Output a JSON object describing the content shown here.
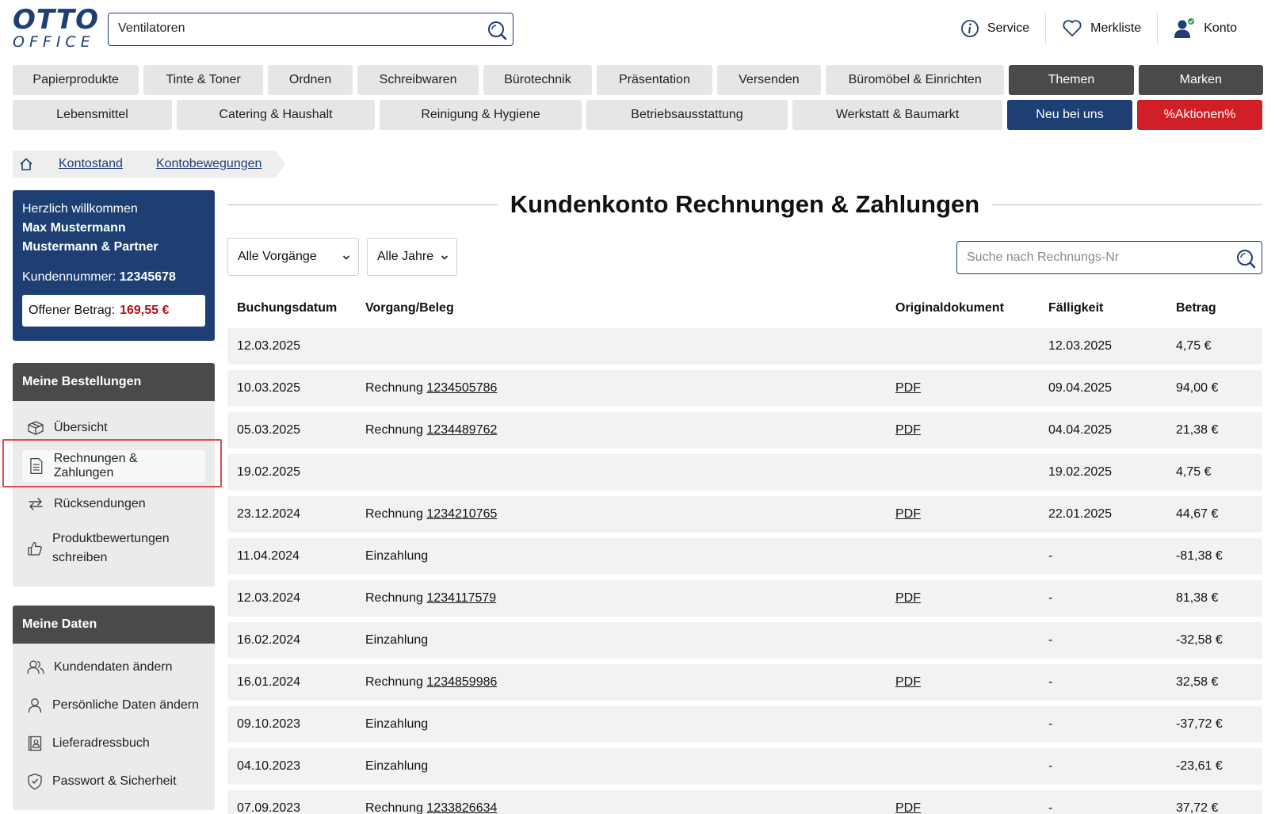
{
  "header": {
    "logo_top": "OTTO",
    "logo_bottom": "OFFICE",
    "search_value": "Ventilatoren",
    "links": {
      "service": "Service",
      "merkliste": "Merkliste",
      "konto": "Konto"
    }
  },
  "nav": {
    "row1": [
      "Papierprodukte",
      "Tinte & Toner",
      "Ordnen",
      "Schreibwaren",
      "Bürotechnik",
      "Präsentation",
      "Versenden",
      "Büromöbel & Einrichten",
      "Themen",
      "Marken"
    ],
    "row2": [
      "Lebensmittel",
      "Catering & Haushalt",
      "Reinigung & Hygiene",
      "Betriebsausstattung",
      "Werkstatt & Baumarkt",
      "Neu bei uns",
      "%Aktionen%"
    ]
  },
  "breadcrumb": [
    "Kontostand",
    "Kontobewegungen"
  ],
  "sidebar": {
    "welcome": {
      "greeting": "Herzlich willkommen",
      "name_line1": "Max Mustermann",
      "name_line2": "Mustermann & Partner",
      "kundennr_label": "Kundennummer:",
      "kundennr": "12345678",
      "offen_label": "Offener Betrag:",
      "offen_value": "169,55 €"
    },
    "bestellungen": {
      "title": "Meine Bestellungen",
      "items": [
        "Übersicht",
        "Rechnungen & Zahlungen",
        "Rücksendungen",
        "Produktbewertungen",
        "schreiben"
      ]
    },
    "daten": {
      "title": "Meine Daten",
      "items": [
        "Kundendaten ändern",
        "Persönliche Daten ändern",
        "Lieferadressbuch",
        "Passwort & Sicherheit"
      ]
    }
  },
  "main": {
    "title": "Kundenkonto Rechnungen & Zahlungen",
    "filter_vorgaenge": "Alle Vorgänge",
    "filter_jahre": "Alle Jahre",
    "search_placeholder": "Suche nach Rechnungs-Nr",
    "columns": [
      "Buchungsdatum",
      "Vorgang/Beleg",
      "Originaldokument",
      "Fälligkeit",
      "Betrag"
    ],
    "rows": [
      {
        "date": "12.03.2025",
        "type": "",
        "nr": "",
        "doc": "",
        "due": "12.03.2025",
        "amount": "4,75 €"
      },
      {
        "date": "10.03.2025",
        "type": "Rechnung",
        "nr": "1234505786",
        "doc": "PDF",
        "due": "09.04.2025",
        "amount": "94,00 €"
      },
      {
        "date": "05.03.2025",
        "type": "Rechnung",
        "nr": "1234489762",
        "doc": "PDF",
        "due": "04.04.2025",
        "amount": "21,38 €"
      },
      {
        "date": "19.02.2025",
        "type": "",
        "nr": "",
        "doc": "",
        "due": "19.02.2025",
        "amount": "4,75 €"
      },
      {
        "date": "23.12.2024",
        "type": "Rechnung",
        "nr": "1234210765",
        "doc": "PDF",
        "due": "22.01.2025",
        "amount": "44,67 €"
      },
      {
        "date": "11.04.2024",
        "type": "Einzahlung",
        "nr": "",
        "doc": "",
        "due": "-",
        "amount": "-81,38 €"
      },
      {
        "date": "12.03.2024",
        "type": "Rechnung",
        "nr": "1234117579",
        "doc": "PDF",
        "due": "-",
        "amount": "81,38 €"
      },
      {
        "date": "16.02.2024",
        "type": "Einzahlung",
        "nr": "",
        "doc": "",
        "due": "-",
        "amount": "-32,58 €"
      },
      {
        "date": "16.01.2024",
        "type": "Rechnung",
        "nr": "1234859986",
        "doc": "PDF",
        "due": "-",
        "amount": "32,58 €"
      },
      {
        "date": "09.10.2023",
        "type": "Einzahlung",
        "nr": "",
        "doc": "",
        "due": "-",
        "amount": "-37,72 €"
      },
      {
        "date": "04.10.2023",
        "type": "Einzahlung",
        "nr": "",
        "doc": "",
        "due": "-",
        "amount": "-23,61 €"
      },
      {
        "date": "07.09.2023",
        "type": "Rechnung",
        "nr": "1233826634",
        "doc": "PDF",
        "due": "-",
        "amount": "37,72 €"
      }
    ]
  },
  "colors": {
    "brand_blue": "#1d3f73",
    "dark_gray": "#4a4a4a",
    "action_red": "#d01f26",
    "amount_red": "#b1141b",
    "highlight": "#e14a4a"
  }
}
